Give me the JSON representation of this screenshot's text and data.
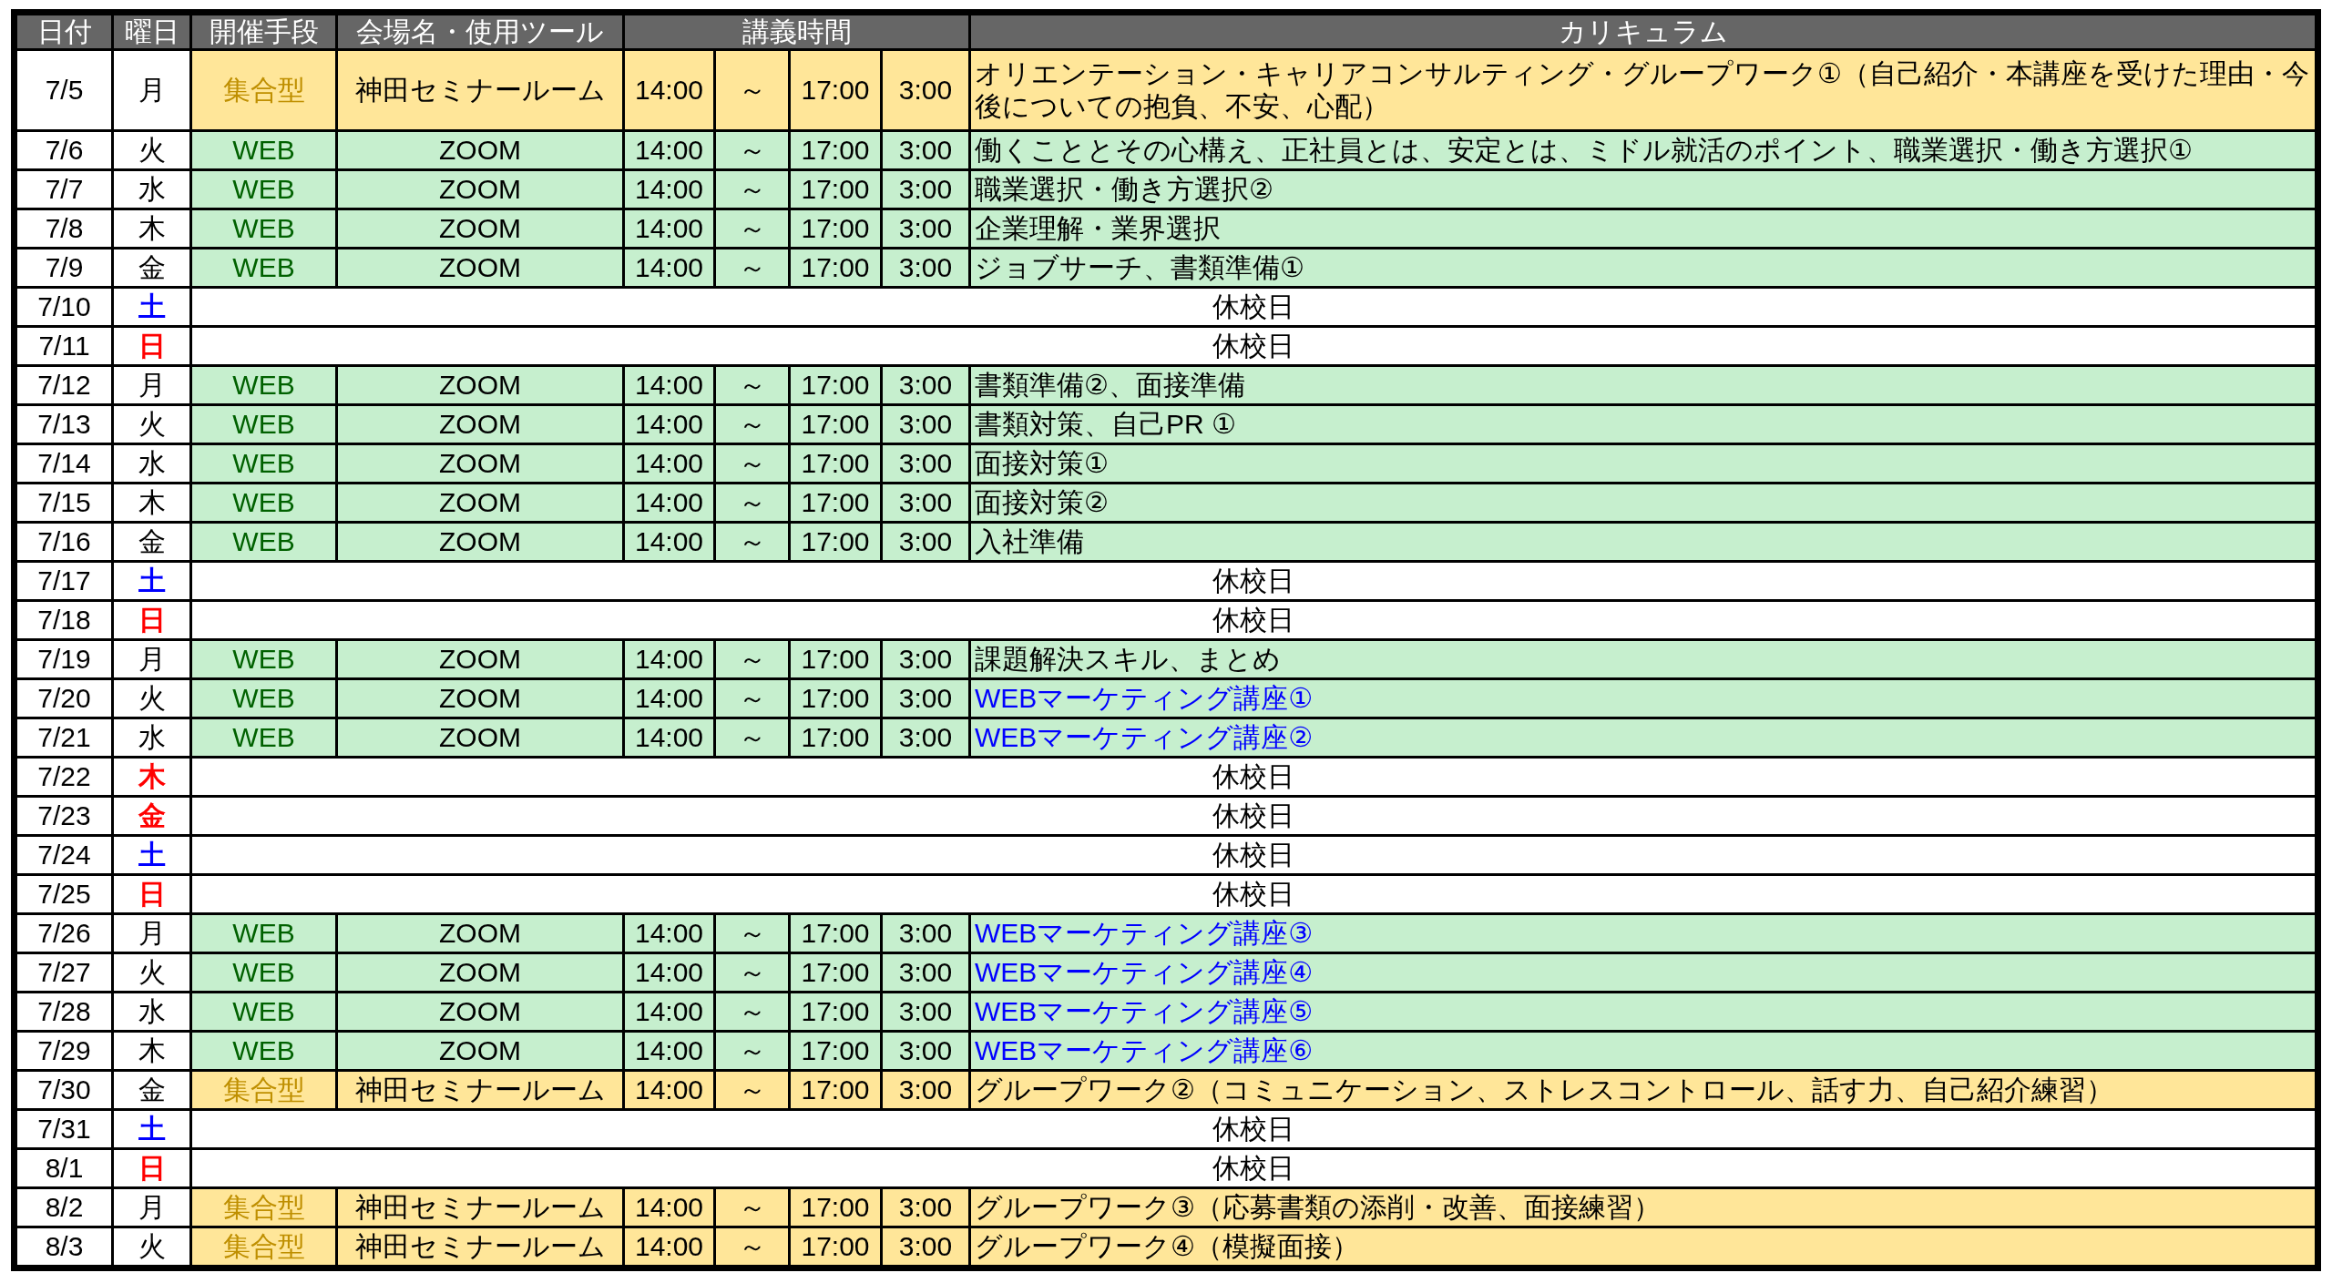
{
  "table": {
    "columns": [
      "日付",
      "曜日",
      "開催手段",
      "会場名・使用ツール",
      "講義時間",
      "カリキュラム"
    ],
    "rows": [
      {
        "kind": "in_person",
        "date": "7/5",
        "day": {
          "text": "月",
          "color": "#000000"
        },
        "method": "集合型",
        "venue": "神田セミナールーム",
        "start": "14:00",
        "sep": "～",
        "end": "17:00",
        "duration": "3:00",
        "curriculum": {
          "text": "オリエンテーション・キャリアコンサルティング・グループワーク①（自己紹介・本講座を受けた理由・今後についての抱負、不安、心配）",
          "emphasis": false
        }
      },
      {
        "kind": "web",
        "date": "7/6",
        "day": {
          "text": "火",
          "color": "#000000"
        },
        "method": "WEB",
        "venue": "ZOOM",
        "start": "14:00",
        "sep": "～",
        "end": "17:00",
        "duration": "3:00",
        "curriculum": {
          "text": "働くこととその心構え、正社員とは、安定とは、ミドル就活のポイント、職業選択・働き方選択①",
          "emphasis": false
        }
      },
      {
        "kind": "web",
        "date": "7/7",
        "day": {
          "text": "水",
          "color": "#000000"
        },
        "method": "WEB",
        "venue": "ZOOM",
        "start": "14:00",
        "sep": "～",
        "end": "17:00",
        "duration": "3:00",
        "curriculum": {
          "text": "職業選択・働き方選択②",
          "emphasis": false
        }
      },
      {
        "kind": "web",
        "date": "7/8",
        "day": {
          "text": "木",
          "color": "#000000"
        },
        "method": "WEB",
        "venue": "ZOOM",
        "start": "14:00",
        "sep": "～",
        "end": "17:00",
        "duration": "3:00",
        "curriculum": {
          "text": "企業理解・業界選択",
          "emphasis": false
        }
      },
      {
        "kind": "web",
        "date": "7/9",
        "day": {
          "text": "金",
          "color": "#000000"
        },
        "method": "WEB",
        "venue": "ZOOM",
        "start": "14:00",
        "sep": "～",
        "end": "17:00",
        "duration": "3:00",
        "curriculum": {
          "text": "ジョブサーチ、書類準備①",
          "emphasis": false
        }
      },
      {
        "kind": "holiday",
        "date": "7/10",
        "day": {
          "text": "土",
          "color": "#0000ff"
        },
        "note": "休校日"
      },
      {
        "kind": "holiday",
        "date": "7/11",
        "day": {
          "text": "日",
          "color": "#ff0000"
        },
        "note": "休校日"
      },
      {
        "kind": "web",
        "date": "7/12",
        "day": {
          "text": "月",
          "color": "#000000"
        },
        "method": "WEB",
        "venue": "ZOOM",
        "start": "14:00",
        "sep": "～",
        "end": "17:00",
        "duration": "3:00",
        "curriculum": {
          "text": "書類準備②、面接準備",
          "emphasis": false
        }
      },
      {
        "kind": "web",
        "date": "7/13",
        "day": {
          "text": "火",
          "color": "#000000"
        },
        "method": "WEB",
        "venue": "ZOOM",
        "start": "14:00",
        "sep": "～",
        "end": "17:00",
        "duration": "3:00",
        "curriculum": {
          "text": "書類対策、自己PR ①",
          "emphasis": false
        }
      },
      {
        "kind": "web",
        "date": "7/14",
        "day": {
          "text": "水",
          "color": "#000000"
        },
        "method": "WEB",
        "venue": "ZOOM",
        "start": "14:00",
        "sep": "～",
        "end": "17:00",
        "duration": "3:00",
        "curriculum": {
          "text": "面接対策①",
          "emphasis": false
        }
      },
      {
        "kind": "web",
        "date": "7/15",
        "day": {
          "text": "木",
          "color": "#000000"
        },
        "method": "WEB",
        "venue": "ZOOM",
        "start": "14:00",
        "sep": "～",
        "end": "17:00",
        "duration": "3:00",
        "curriculum": {
          "text": "面接対策②",
          "emphasis": false
        }
      },
      {
        "kind": "web",
        "date": "7/16",
        "day": {
          "text": "金",
          "color": "#000000"
        },
        "method": "WEB",
        "venue": "ZOOM",
        "start": "14:00",
        "sep": "～",
        "end": "17:00",
        "duration": "3:00",
        "curriculum": {
          "text": "入社準備",
          "emphasis": false
        }
      },
      {
        "kind": "holiday",
        "date": "7/17",
        "day": {
          "text": "土",
          "color": "#0000ff"
        },
        "note": "休校日"
      },
      {
        "kind": "holiday",
        "date": "7/18",
        "day": {
          "text": "日",
          "color": "#ff0000"
        },
        "note": "休校日"
      },
      {
        "kind": "web",
        "date": "7/19",
        "day": {
          "text": "月",
          "color": "#000000"
        },
        "method": "WEB",
        "venue": "ZOOM",
        "start": "14:00",
        "sep": "～",
        "end": "17:00",
        "duration": "3:00",
        "curriculum": {
          "text": "課題解決スキル、まとめ",
          "emphasis": false
        }
      },
      {
        "kind": "web",
        "date": "7/20",
        "day": {
          "text": "火",
          "color": "#000000"
        },
        "method": "WEB",
        "venue": "ZOOM",
        "start": "14:00",
        "sep": "～",
        "end": "17:00",
        "duration": "3:00",
        "curriculum": {
          "text": "WEBマーケティング講座①",
          "emphasis": true
        }
      },
      {
        "kind": "web",
        "date": "7/21",
        "day": {
          "text": "水",
          "color": "#000000"
        },
        "method": "WEB",
        "venue": "ZOOM",
        "start": "14:00",
        "sep": "～",
        "end": "17:00",
        "duration": "3:00",
        "curriculum": {
          "text": "WEBマーケティング講座②",
          "emphasis": true
        }
      },
      {
        "kind": "holiday",
        "date": "7/22",
        "day": {
          "text": "木",
          "color": "#ff0000"
        },
        "note": "休校日"
      },
      {
        "kind": "holiday",
        "date": "7/23",
        "day": {
          "text": "金",
          "color": "#ff0000"
        },
        "note": "休校日"
      },
      {
        "kind": "holiday",
        "date": "7/24",
        "day": {
          "text": "土",
          "color": "#0000ff"
        },
        "note": "休校日"
      },
      {
        "kind": "holiday",
        "date": "7/25",
        "day": {
          "text": "日",
          "color": "#ff0000"
        },
        "note": "休校日"
      },
      {
        "kind": "web",
        "date": "7/26",
        "day": {
          "text": "月",
          "color": "#000000"
        },
        "method": "WEB",
        "venue": "ZOOM",
        "start": "14:00",
        "sep": "～",
        "end": "17:00",
        "duration": "3:00",
        "curriculum": {
          "text": "WEBマーケティング講座③",
          "emphasis": true
        }
      },
      {
        "kind": "web",
        "date": "7/27",
        "day": {
          "text": "火",
          "color": "#000000"
        },
        "method": "WEB",
        "venue": "ZOOM",
        "start": "14:00",
        "sep": "～",
        "end": "17:00",
        "duration": "3:00",
        "curriculum": {
          "text": "WEBマーケティング講座④",
          "emphasis": true
        }
      },
      {
        "kind": "web",
        "date": "7/28",
        "day": {
          "text": "水",
          "color": "#000000"
        },
        "method": "WEB",
        "venue": "ZOOM",
        "start": "14:00",
        "sep": "～",
        "end": "17:00",
        "duration": "3:00",
        "curriculum": {
          "text": "WEBマーケティング講座⑤",
          "emphasis": true
        }
      },
      {
        "kind": "web",
        "date": "7/29",
        "day": {
          "text": "木",
          "color": "#000000"
        },
        "method": "WEB",
        "venue": "ZOOM",
        "start": "14:00",
        "sep": "～",
        "end": "17:00",
        "duration": "3:00",
        "curriculum": {
          "text": "WEBマーケティング講座⑥",
          "emphasis": true
        }
      },
      {
        "kind": "in_person",
        "date": "7/30",
        "day": {
          "text": "金",
          "color": "#000000"
        },
        "method": "集合型",
        "venue": "神田セミナールーム",
        "start": "14:00",
        "sep": "～",
        "end": "17:00",
        "duration": "3:00",
        "curriculum": {
          "text": "グループワーク②（コミュニケーション、ストレスコントロール、話す力、自己紹介練習）",
          "emphasis": false
        }
      },
      {
        "kind": "holiday",
        "date": "7/31",
        "day": {
          "text": "土",
          "color": "#0000ff"
        },
        "note": "休校日"
      },
      {
        "kind": "holiday",
        "date": "8/1",
        "day": {
          "text": "日",
          "color": "#ff0000"
        },
        "note": "休校日"
      },
      {
        "kind": "in_person",
        "date": "8/2",
        "day": {
          "text": "月",
          "color": "#000000"
        },
        "method": "集合型",
        "venue": "神田セミナールーム",
        "start": "14:00",
        "sep": "～",
        "end": "17:00",
        "duration": "3:00",
        "curriculum": {
          "text": "グループワーク③（応募書類の添削・改善、面接練習）",
          "emphasis": false
        }
      },
      {
        "kind": "in_person",
        "date": "8/3",
        "day": {
          "text": "火",
          "color": "#000000"
        },
        "method": "集合型",
        "venue": "神田セミナールーム",
        "start": "14:00",
        "sep": "～",
        "end": "17:00",
        "duration": "3:00",
        "curriculum": {
          "text": "グループワーク④（模擬面接）",
          "emphasis": false
        }
      }
    ]
  }
}
